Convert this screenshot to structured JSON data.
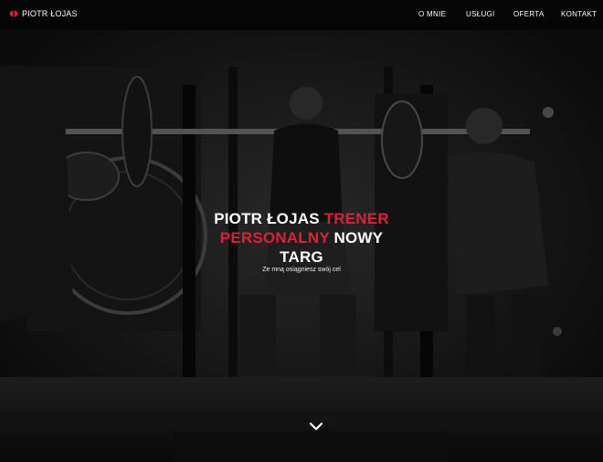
{
  "brand": {
    "name": "PIOTR ŁOJAS",
    "logo_icon": "kettlebell-logo-icon",
    "accent_color": "#d8223a"
  },
  "nav": {
    "items": [
      {
        "label": "O MNIE"
      },
      {
        "label": "USŁUGI"
      },
      {
        "label": "OFERTA"
      },
      {
        "label": "KONTAKT"
      }
    ]
  },
  "hero": {
    "title_part1": "PIOTR ŁOJAS",
    "title_highlight": "TRENER PERSONALNY",
    "title_part2": "NOWY TARG",
    "subtitle": "Ze mną osiągniesz swój cel",
    "scroll_icon": "chevron-down-icon",
    "background": "black-and-white gym photo of powerlifting squat"
  }
}
